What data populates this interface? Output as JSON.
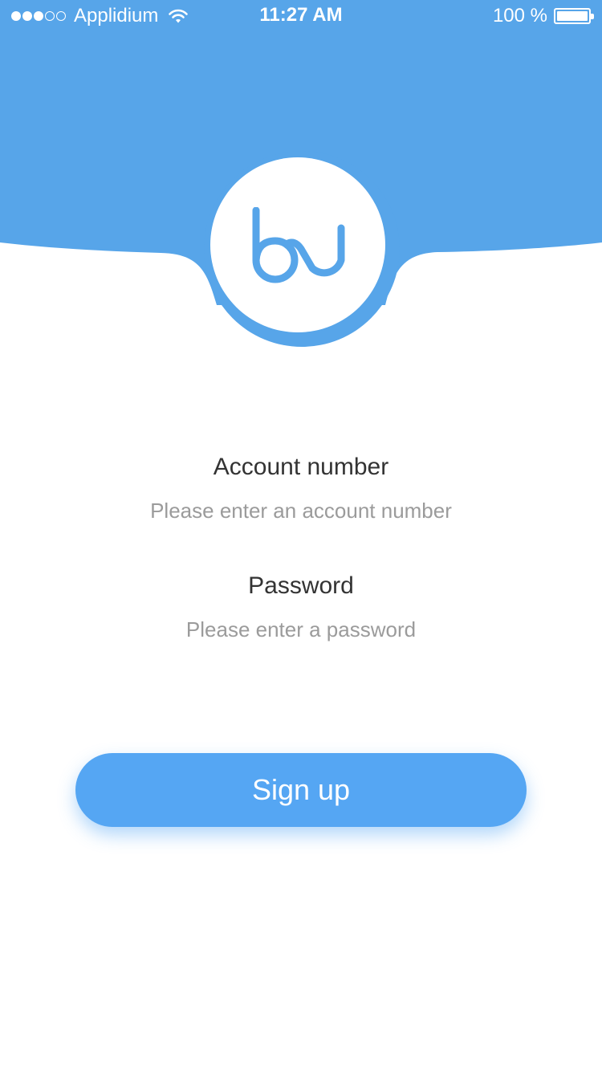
{
  "status_bar": {
    "carrier": "Applidium",
    "time": "11:27 AM",
    "battery": "100 %",
    "signal_strength": "3 of 5 bars",
    "wifi_icon": "wifi-icon",
    "battery_icon": "battery-icon"
  },
  "logo": {
    "icon": "bj-logo-icon",
    "color": "#57a5e9"
  },
  "form": {
    "account_label": "Account number",
    "account_placeholder": "Please enter an account number",
    "account_value": "",
    "password_label": "Password",
    "password_placeholder": "Please enter a password",
    "password_value": ""
  },
  "actions": {
    "signup_label": "Sign up"
  },
  "colors": {
    "header": "#57a5e9",
    "button": "#55a6f3",
    "label_text": "#333333",
    "placeholder_text": "#9b9b9b"
  }
}
